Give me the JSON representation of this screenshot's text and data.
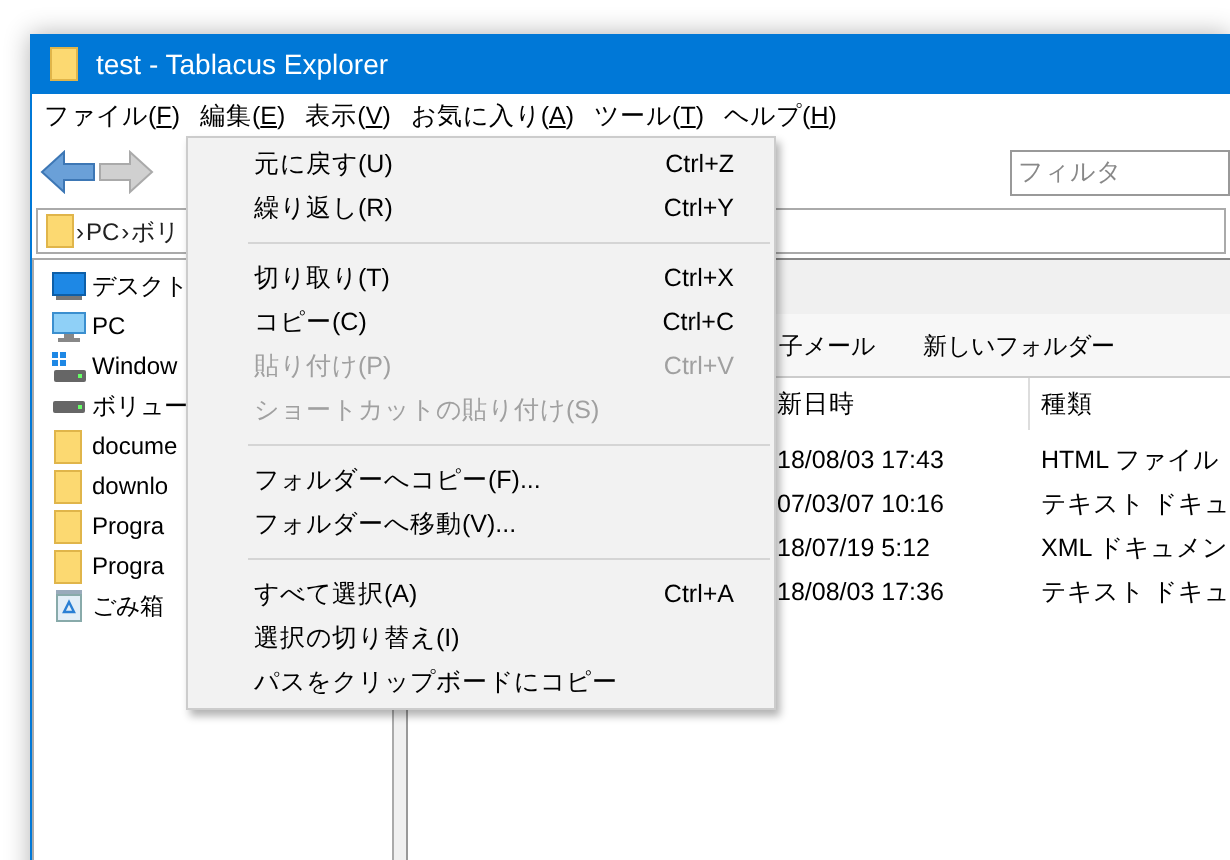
{
  "window": {
    "title": "test - Tablacus Explorer"
  },
  "menubar": [
    {
      "before": "ファイル(",
      "key": "F",
      "after": ")"
    },
    {
      "before": "編集(",
      "key": "E",
      "after": ")"
    },
    {
      "before": "表示(",
      "key": "V",
      "after": ")"
    },
    {
      "before": "お気に入り(",
      "key": "A",
      "after": ")"
    },
    {
      "before": "ツール(",
      "key": "T",
      "after": ")"
    },
    {
      "before": "ヘルプ(",
      "key": "H",
      "after": ")"
    }
  ],
  "toolbar": {
    "filter": {
      "placeholder": "フィルタ"
    }
  },
  "address": {
    "parts": [
      "›",
      "PC",
      "›",
      "ボリ"
    ]
  },
  "tree": [
    {
      "kind": "desktop",
      "label": "デスクト"
    },
    {
      "kind": "pc",
      "label": "PC"
    },
    {
      "kind": "windows-drive",
      "label": "Window"
    },
    {
      "kind": "drive",
      "label": "ボリュー"
    },
    {
      "kind": "folder",
      "label": "docume"
    },
    {
      "kind": "folder",
      "label": "downlo"
    },
    {
      "kind": "folder",
      "label": "Progra"
    },
    {
      "kind": "folder",
      "label": "Progra"
    },
    {
      "kind": "recycle-bin",
      "label": "ごみ箱"
    }
  ],
  "file_toolbar": [
    "子メール",
    "新しいフォルダー"
  ],
  "table": {
    "columns": [
      "新日時",
      "種類"
    ],
    "rows": [
      [
        "18/08/03 17:43",
        "HTML ファイル"
      ],
      [
        "07/03/07 10:16",
        "テキスト ドキュ"
      ],
      [
        "18/07/19 5:12",
        "XML ドキュメン"
      ],
      [
        "18/08/03 17:36",
        "テキスト ドキュ"
      ]
    ]
  },
  "edit_menu": [
    {
      "kind": "item",
      "label": "元に戻す(U)",
      "shortcut": "Ctrl+Z",
      "disabled": false
    },
    {
      "kind": "item",
      "label": "繰り返し(R)",
      "shortcut": "Ctrl+Y",
      "disabled": false
    },
    {
      "kind": "separator"
    },
    {
      "kind": "item",
      "label": "切り取り(T)",
      "shortcut": "Ctrl+X",
      "disabled": false
    },
    {
      "kind": "item",
      "label": "コピー(C)",
      "shortcut": "Ctrl+C",
      "disabled": false
    },
    {
      "kind": "item",
      "label": "貼り付け(P)",
      "shortcut": "Ctrl+V",
      "disabled": true
    },
    {
      "kind": "item",
      "label": "ショートカットの貼り付け(S)",
      "disabled": true
    },
    {
      "kind": "separator"
    },
    {
      "kind": "item",
      "label": "フォルダーへコピー(F)...",
      "disabled": false
    },
    {
      "kind": "item",
      "label": "フォルダーへ移動(V)...",
      "disabled": false
    },
    {
      "kind": "separator"
    },
    {
      "kind": "item",
      "label": "すべて選択(A)",
      "shortcut": "Ctrl+A",
      "disabled": false
    },
    {
      "kind": "item",
      "label": "選択の切り替え(I)",
      "disabled": false
    },
    {
      "kind": "item",
      "label": "パスをクリップボードにコピー",
      "disabled": false
    }
  ]
}
